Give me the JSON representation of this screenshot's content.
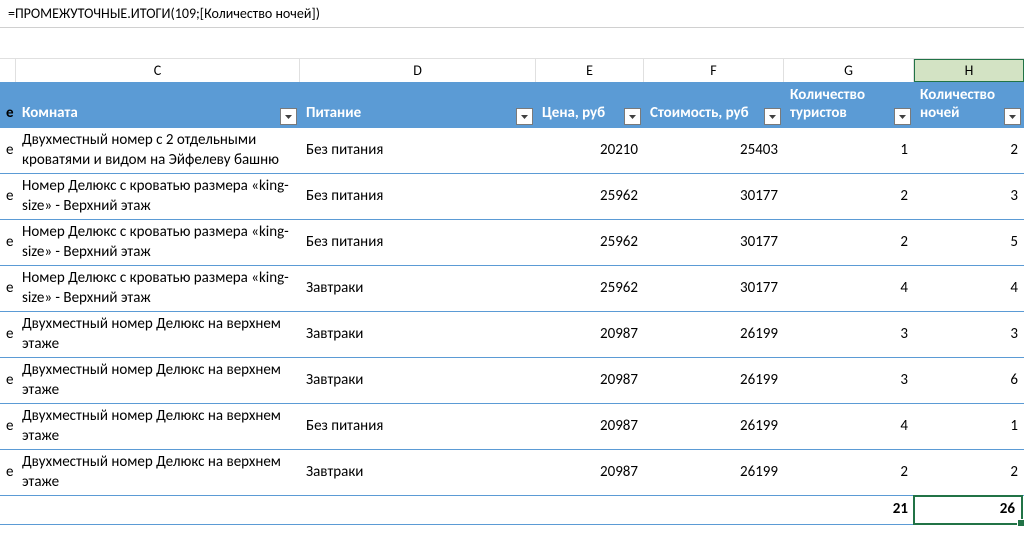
{
  "formula": "=ПРОМЕЖУТОЧНЫЕ.ИТОГИ(109;[Количество ночей])",
  "columns": {
    "b": "",
    "c": "C",
    "d": "D",
    "e": "E",
    "f": "F",
    "g": "G",
    "h": "H"
  },
  "header": {
    "stub": "е",
    "room": "Комната",
    "meal": "Питание",
    "price": "Цена, руб",
    "cost": "Стоимость, руб",
    "tourists": "Количество туристов",
    "nights": "Количество ночей"
  },
  "rows": [
    {
      "stub": "е",
      "room": "Двухместный номер с 2 отдельными кроватями и видом на Эйфелеву башню",
      "meal": "Без питания",
      "price": "20210",
      "cost": "25403",
      "tourists": "1",
      "nights": "2"
    },
    {
      "stub": "е",
      "room": "Номер Делюкс с кроватью размера «king-size» - Верхний этаж",
      "meal": "Без питания",
      "price": "25962",
      "cost": "30177",
      "tourists": "2",
      "nights": "3"
    },
    {
      "stub": "е",
      "room": "Номер Делюкс с кроватью размера «king-size» - Верхний этаж",
      "meal": "Без питания",
      "price": "25962",
      "cost": "30177",
      "tourists": "2",
      "nights": "5"
    },
    {
      "stub": "е",
      "room": "Номер Делюкс с кроватью размера «king-size» - Верхний этаж",
      "meal": "Завтраки",
      "price": "25962",
      "cost": "30177",
      "tourists": "4",
      "nights": "4"
    },
    {
      "stub": "е",
      "room": "Двухместный номер Делюкс на верхнем этаже",
      "meal": "Завтраки",
      "price": "20987",
      "cost": "26199",
      "tourists": "3",
      "nights": "3"
    },
    {
      "stub": "е",
      "room": "Двухместный номер Делюкс на верхнем этаже",
      "meal": "Завтраки",
      "price": "20987",
      "cost": "26199",
      "tourists": "3",
      "nights": "6"
    },
    {
      "stub": "е",
      "room": "Двухместный номер Делюкс на верхнем этаже",
      "meal": "Без питания",
      "price": "20987",
      "cost": "26199",
      "tourists": "4",
      "nights": "1"
    },
    {
      "stub": "е",
      "room": "Двухместный номер Делюкс на верхнем этаже",
      "meal": "Завтраки",
      "price": "20987",
      "cost": "26199",
      "tourists": "2",
      "nights": "2"
    }
  ],
  "totals": {
    "tourists": "21",
    "nights": "26"
  }
}
